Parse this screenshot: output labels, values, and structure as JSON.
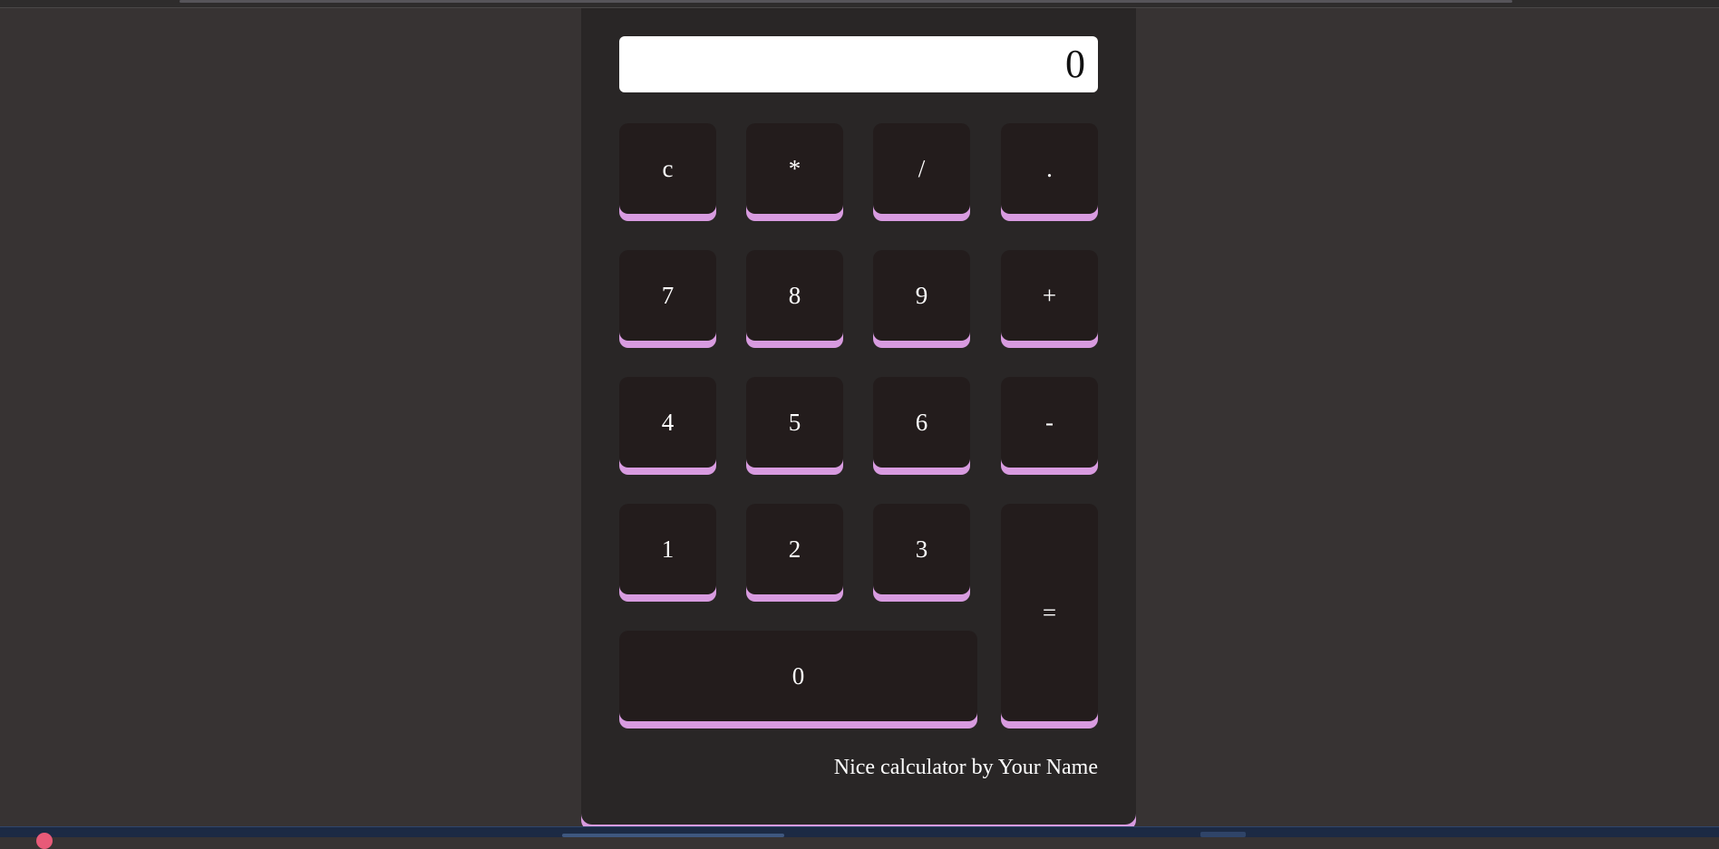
{
  "display": {
    "value": "0"
  },
  "keys": {
    "clear": "c",
    "multiply": "*",
    "divide": "/",
    "decimal": ".",
    "seven": "7",
    "eight": "8",
    "nine": "9",
    "plus": "+",
    "four": "4",
    "five": "5",
    "six": "6",
    "minus": "-",
    "one": "1",
    "two": "2",
    "three": "3",
    "equals": "=",
    "zero": "0"
  },
  "footer": {
    "credit": "Nice calculator by Your Name"
  },
  "colors": {
    "page_background": "#373333",
    "calculator_background": "#292626",
    "key_background": "#231c1c",
    "key_accent": "#d89be0",
    "display_background": "#ffffff"
  }
}
